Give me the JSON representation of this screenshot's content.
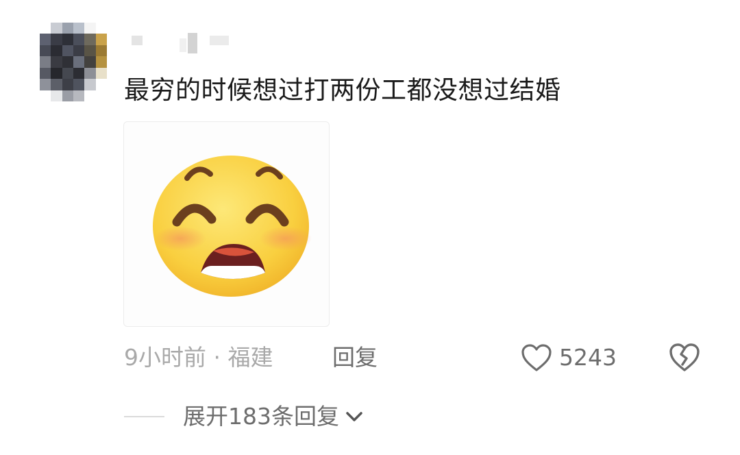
{
  "comment": {
    "text": "最穷的时候想过打两份工都没想过结婚",
    "sticker": "grinning-face-sticker",
    "time_location": "9小时前 · 福建",
    "reply_label": "回复",
    "like_count": "5243",
    "expand_replies_label": "展开183条回复"
  },
  "icons": {
    "like": "heart-outline-icon",
    "dislike": "broken-heart-icon",
    "expand": "chevron-down-icon"
  },
  "colors": {
    "text_primary": "#1b1b1b",
    "text_secondary": "#6d6d6d",
    "text_meta": "#a9a9a9",
    "emoji_face": "#fbd34a"
  }
}
